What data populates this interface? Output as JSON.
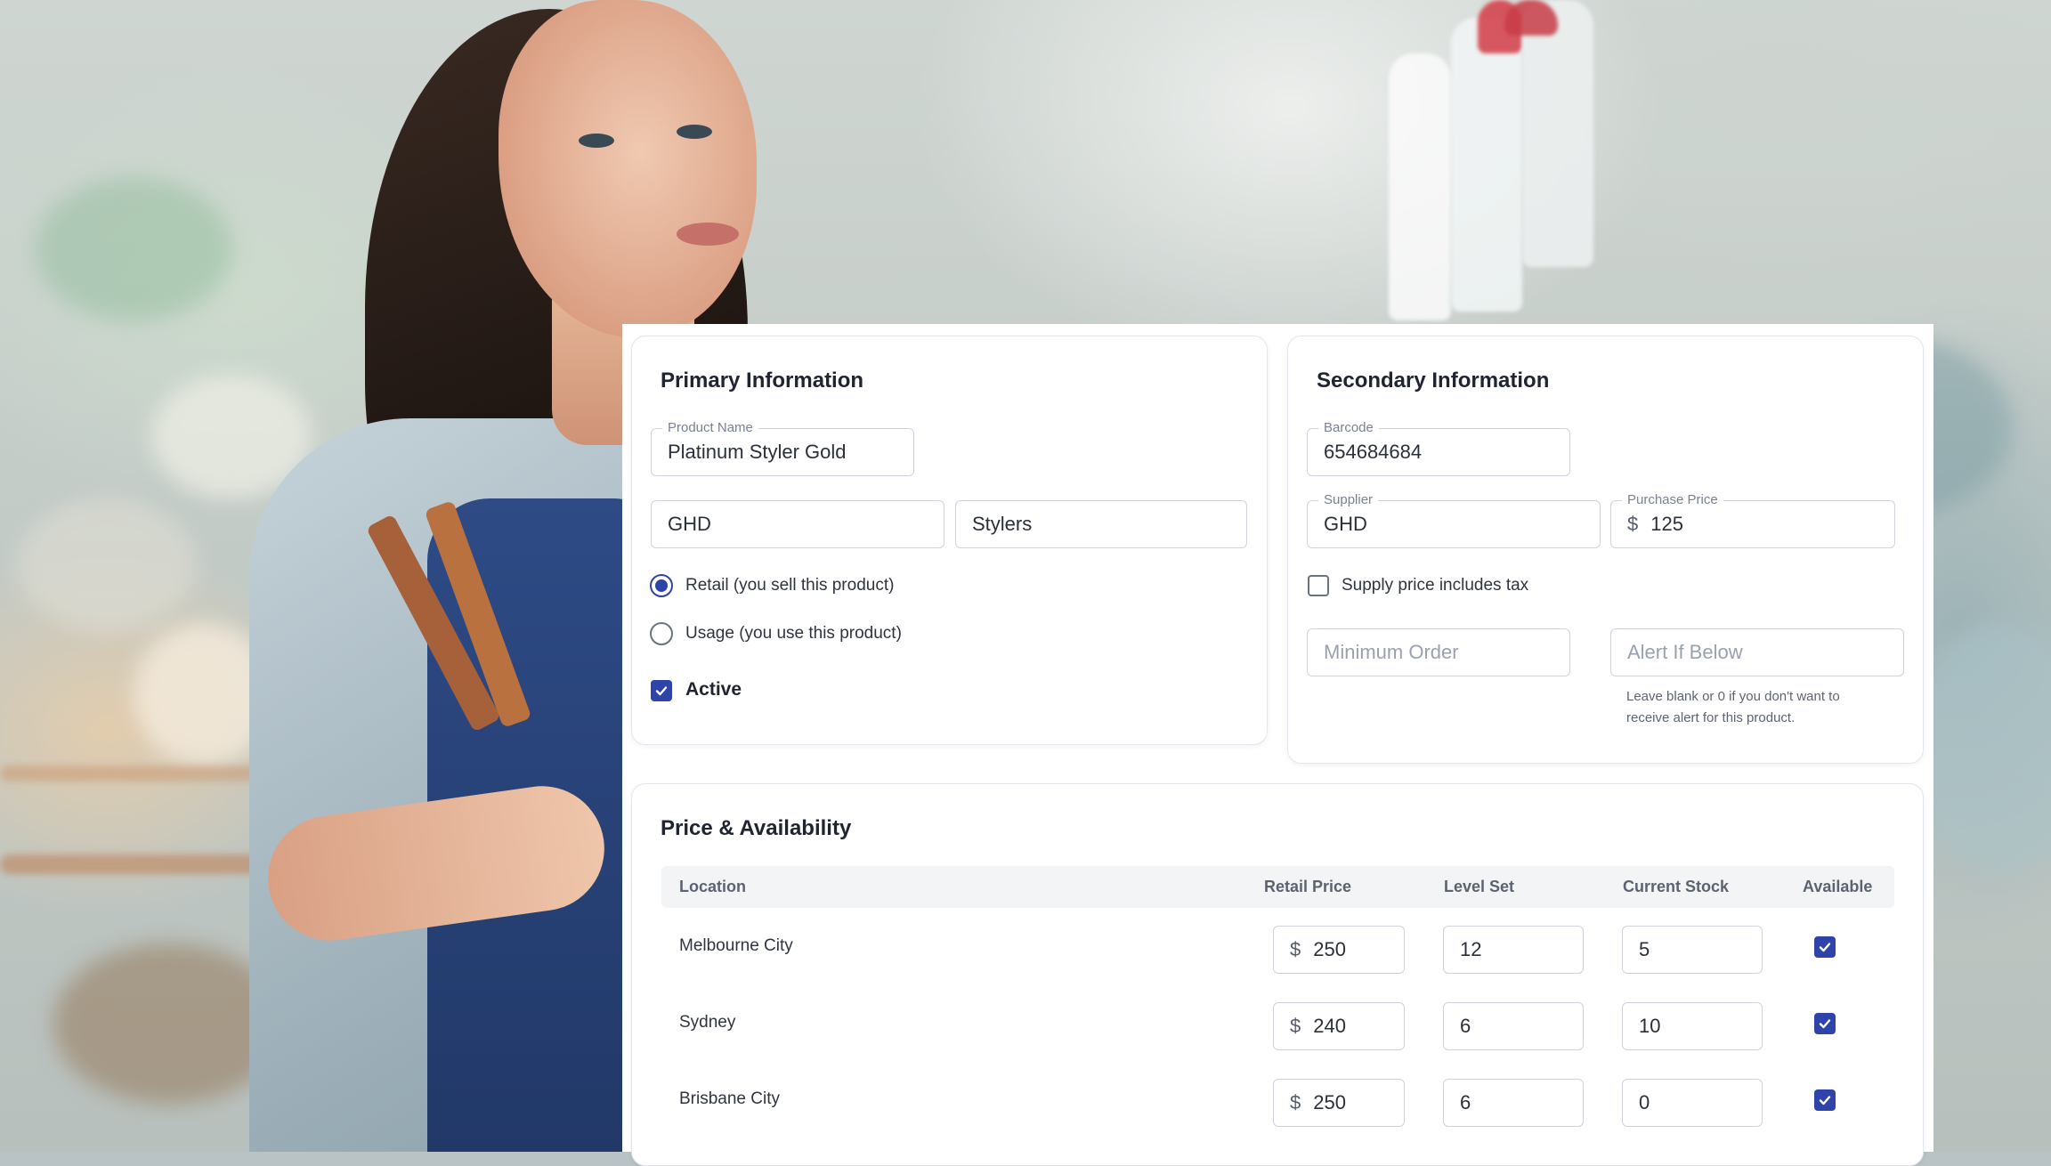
{
  "primary": {
    "title": "Primary Information",
    "product_name_label": "Product Name",
    "product_name": "Platinum Styler Gold",
    "brand": "GHD",
    "category": "Stylers",
    "retail_label": "Retail (you sell this product)",
    "usage_label": "Usage (you use this product)",
    "selected_type": "retail",
    "active_label": "Active",
    "active": true
  },
  "secondary": {
    "title": "Secondary Information",
    "barcode_label": "Barcode",
    "barcode": "654684684",
    "supplier_label": "Supplier",
    "supplier": "GHD",
    "purchase_price_label": "Purchase Price",
    "currency": "$",
    "purchase_price": "125",
    "supply_tax_label": "Supply price includes tax",
    "supply_tax": false,
    "minimum_order_placeholder": "Minimum Order",
    "alert_placeholder": "Alert If Below",
    "alert_hint_1": "Leave blank or 0 if you don't want to",
    "alert_hint_2": "receive alert for this product."
  },
  "availability": {
    "title": "Price & Availability",
    "columns": [
      "Location",
      "Retail Price",
      "Level Set",
      "Current Stock",
      "Available"
    ],
    "rows": [
      {
        "location": "Melbourne City",
        "retail_price": "250",
        "level_set": "12",
        "current_stock": "5",
        "available": true
      },
      {
        "location": "Sydney",
        "retail_price": "240",
        "level_set": "6",
        "current_stock": "10",
        "available": true
      },
      {
        "location": "Brisbane City",
        "retail_price": "250",
        "level_set": "6",
        "current_stock": "0",
        "available": true
      }
    ]
  },
  "colors": {
    "accent": "#2f44a8",
    "border": "#cfd3db",
    "text": "#1f2430"
  }
}
